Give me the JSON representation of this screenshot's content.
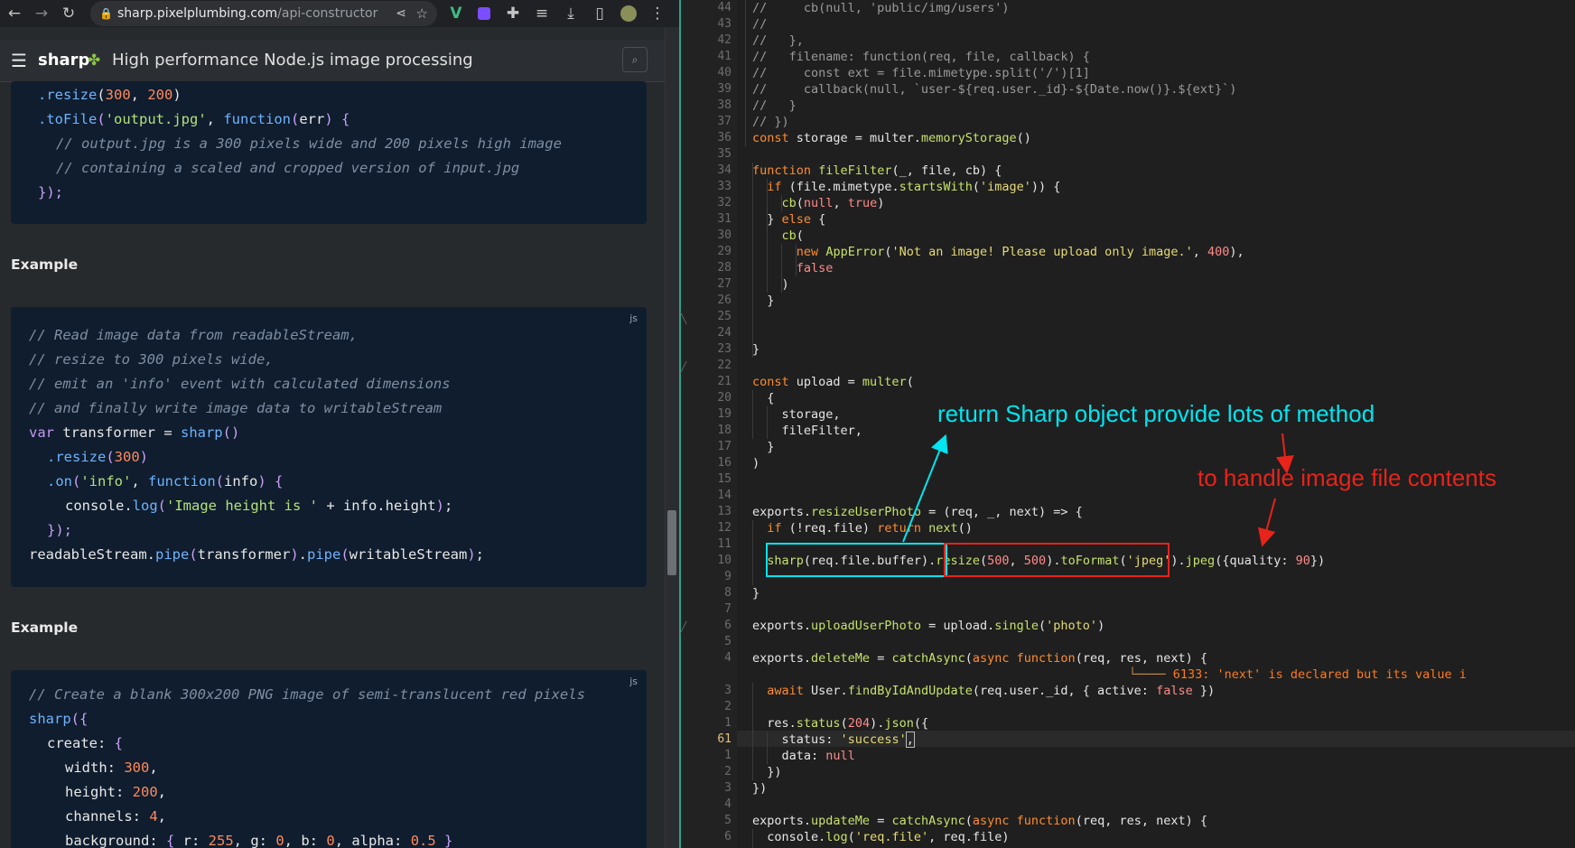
{
  "browser": {
    "url_host": "sharp.pixelplumbing.com",
    "url_path": "/api-constructor",
    "site_title": "sharp",
    "site_tagline": "High performance Node.js image processing",
    "icons": {
      "back": "arrow-left-icon",
      "forward": "arrow-right-icon",
      "reload": "reload-icon",
      "lock": "lock-icon",
      "share": "share-icon",
      "bookmark": "star-icon",
      "menu": "hamburger-menu-icon",
      "search": "search-icon",
      "logo": "leaf-icon"
    },
    "accent_colors": {
      "code_bg": "#0f1d2e",
      "comment": "#7f8ea3",
      "function": "#6fb3ff",
      "string": "#b5e07a",
      "number": "#ff8a5c"
    }
  },
  "doc": {
    "block1": {
      "lines": [
        "  .resize(300, 200)",
        "  .toFile('output.jpg', function(err) {",
        "    // output.jpg is a 300 pixels wide and 200 pixels high image",
        "    // containing a scaled and cropped version of input.jpg",
        "  });"
      ]
    },
    "label1": "Example",
    "block2": {
      "badge": "js",
      "lines": [
        "// Read image data from readableStream,",
        "// resize to 300 pixels wide,",
        "// emit an 'info' event with calculated dimensions",
        "// and finally write image data to writableStream",
        "var transformer = sharp()",
        "  .resize(300)",
        "  .on('info', function(info) {",
        "    console.log('Image height is ' + info.height);",
        "  });",
        "readableStream.pipe(transformer).pipe(writableStream);"
      ]
    },
    "label2": "Example",
    "block3": {
      "badge": "js",
      "lines": [
        "// Create a blank 300x200 PNG image of semi-translucent red pixels",
        "sharp({",
        "  create: {",
        "    width: 300,",
        "    height: 200,",
        "    channels: 4,",
        "    background: { r: 255, g: 0, b: 0, alpha: 0.5 }"
      ]
    }
  },
  "editor": {
    "active_line_number": "61",
    "line_numbers": [
      "44",
      "43",
      "42",
      "41",
      "40",
      "39",
      "38",
      "37",
      "36",
      "35",
      "34",
      "33",
      "32",
      "31",
      "30",
      "29",
      "28",
      "27",
      "26",
      "25",
      "24",
      "23",
      "22",
      "21",
      "20",
      "19",
      "18",
      "17",
      "16",
      "15",
      "14",
      "13",
      "12",
      "11",
      "10",
      "9",
      "8",
      "7",
      "6",
      "5",
      "4",
      "",
      "3",
      "2",
      "1",
      "61",
      "1",
      "2",
      "3",
      "4",
      "5",
      "6"
    ],
    "lines": [
      "//     cb(null, 'public/img/users')",
      "//",
      "//   },",
      "//   filename: function(req, file, callback) {",
      "//     const ext = file.mimetype.split('/')[1]",
      "//     callback(null, `user-${req.user._id}-${Date.now()}.${ext}`)",
      "//   }",
      "// })",
      "const storage = multer.memoryStorage()",
      "",
      "function fileFilter(_, file, cb) {",
      "  if (file.mimetype.startsWith('image')) {",
      "    cb(null, true)",
      "  } else {",
      "    cb(",
      "      new AppError('Not an image! Please upload only image.', 400),",
      "      false",
      "    )",
      "  }",
      "",
      "",
      "}",
      "",
      "const upload = multer(",
      "  {",
      "    storage,",
      "    fileFilter,",
      "  }",
      ")",
      "",
      "",
      "exports.resizeUserPhoto = (req, _, next) => {",
      "  if (!req.file) return next()",
      "",
      "  sharp(req.file.buffer).resize(500, 500).toFormat('jpeg').jpeg({quality: 90})",
      "",
      "}",
      "",
      "exports.uploadUserPhoto = upload.single('photo')",
      "",
      "exports.deleteMe = catchAsync(async function(req, res, next) {",
      "",
      "  await User.findByIdAndUpdate(req.user._id, { active: false })",
      "",
      "  res.status(204).json({",
      "    status: 'success',",
      "    data: null",
      "  })",
      "})",
      "",
      "exports.updateMe = catchAsync(async function(req, res, next) {",
      "  console.log('req.file', req.file)"
    ],
    "inline_warning": "6133: 'next' is declared but its value i",
    "icons": {
      "fold_markers": "fold-marker-icon"
    }
  },
  "annotations": {
    "cyan_text": "return Sharp object provide lots of method",
    "red_text": "to handle image file contents",
    "cyan_color": "#00e5f0",
    "red_color": "#e8231a"
  }
}
